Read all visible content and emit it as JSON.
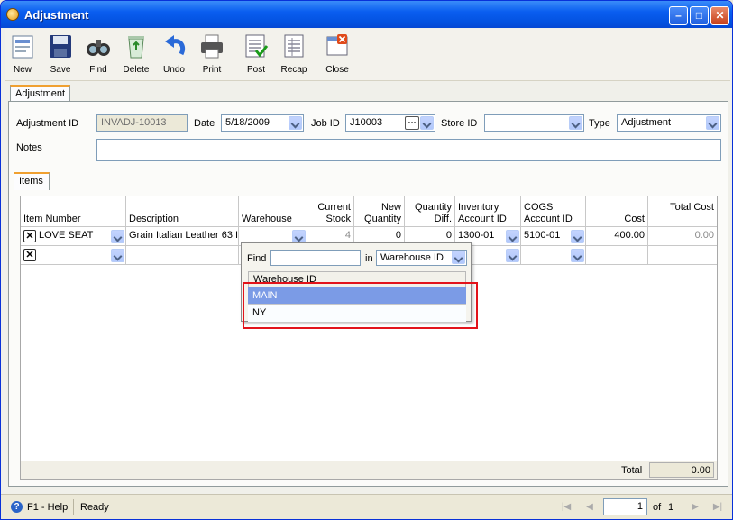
{
  "window": {
    "title": "Adjustment"
  },
  "toolbar": {
    "items": [
      {
        "label": "New",
        "icon": "new-document-icon"
      },
      {
        "label": "Save",
        "icon": "floppy-disk-icon"
      },
      {
        "label": "Find",
        "icon": "binoculars-icon"
      },
      {
        "label": "Delete",
        "icon": "recycle-bin-icon"
      },
      {
        "label": "Undo",
        "icon": "undo-arrow-icon"
      },
      {
        "label": "Print",
        "icon": "printer-icon"
      },
      {
        "label": "Post",
        "icon": "post-ledger-icon"
      },
      {
        "label": "Recap",
        "icon": "recap-ledger-icon"
      },
      {
        "label": "Close",
        "icon": "close-window-icon"
      }
    ]
  },
  "tab": {
    "label": "Adjustment"
  },
  "form": {
    "adjustment_id_label": "Adjustment ID",
    "adjustment_id": "INVADJ-10013",
    "date_label": "Date",
    "date": "5/18/2009",
    "job_id_label": "Job ID",
    "job_id": "J10003",
    "store_id_label": "Store ID",
    "store_id": "",
    "type_label": "Type",
    "type": "Adjustment",
    "notes_label": "Notes",
    "notes": ""
  },
  "items_tab": {
    "label": "Items"
  },
  "grid": {
    "columns": [
      {
        "line1": "",
        "line2": "Item Number"
      },
      {
        "line1": "",
        "line2": "Description"
      },
      {
        "line1": "",
        "line2": "Warehouse"
      },
      {
        "line1": "Current",
        "line2": "Stock"
      },
      {
        "line1": "New",
        "line2": "Quantity"
      },
      {
        "line1": "Quantity",
        "line2": "Diff."
      },
      {
        "line1": "Inventory",
        "line2": "Account ID"
      },
      {
        "line1": "COGS",
        "line2": "Account ID"
      },
      {
        "line1": "",
        "line2": "Cost"
      },
      {
        "line1": "",
        "line2": "Total Cost"
      }
    ],
    "rows": [
      {
        "item_number": "LOVE SEAT",
        "description": "Grain Italian Leather 63 I",
        "warehouse": "",
        "current_stock": "4",
        "new_quantity": "0",
        "quantity_diff": "0",
        "inventory_account": "1300-01",
        "cogs_account": "5100-01",
        "cost": "400.00",
        "total_cost": "0.00"
      }
    ],
    "total_label": "Total",
    "total_value": "0.00"
  },
  "dropdown": {
    "find_label": "Find",
    "find_value": "",
    "in_label": "in",
    "in_field": "Warehouse ID",
    "column_header": "Warehouse ID",
    "options": [
      "MAIN",
      "NY"
    ],
    "selected": "MAIN"
  },
  "status": {
    "help": "F1 - Help",
    "state": "Ready",
    "page": "1",
    "of_label": "of",
    "total_pages": "1"
  },
  "colors": {
    "title_bar": "#0a5ef0",
    "selected_row": "#7b9be6",
    "highlight_box": "#e2131b"
  }
}
